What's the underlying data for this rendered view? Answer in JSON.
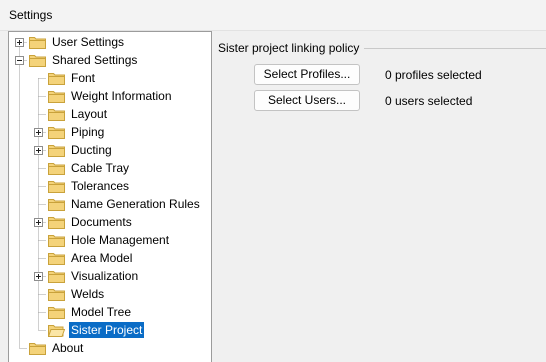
{
  "window": {
    "title": "Settings"
  },
  "tree": {
    "items": [
      {
        "label": "User Settings",
        "level": 0,
        "expander": "plus"
      },
      {
        "label": "Shared Settings",
        "level": 0,
        "expander": "minus"
      },
      {
        "label": "Font",
        "level": 1,
        "expander": ""
      },
      {
        "label": "Weight Information",
        "level": 1,
        "expander": ""
      },
      {
        "label": "Layout",
        "level": 1,
        "expander": ""
      },
      {
        "label": "Piping",
        "level": 1,
        "expander": "plus"
      },
      {
        "label": "Ducting",
        "level": 1,
        "expander": "plus"
      },
      {
        "label": "Cable Tray",
        "level": 1,
        "expander": ""
      },
      {
        "label": "Tolerances",
        "level": 1,
        "expander": ""
      },
      {
        "label": "Name Generation Rules",
        "level": 1,
        "expander": ""
      },
      {
        "label": "Documents",
        "level": 1,
        "expander": "plus"
      },
      {
        "label": "Hole Management",
        "level": 1,
        "expander": ""
      },
      {
        "label": "Area Model",
        "level": 1,
        "expander": ""
      },
      {
        "label": "Visualization",
        "level": 1,
        "expander": "plus"
      },
      {
        "label": "Welds",
        "level": 1,
        "expander": ""
      },
      {
        "label": "Model Tree",
        "level": 1,
        "expander": ""
      },
      {
        "label": "Sister Project",
        "level": 1,
        "expander": "",
        "selected": true
      },
      {
        "label": "About",
        "level": 0,
        "expander": ""
      }
    ]
  },
  "panel": {
    "group_title": "Sister project linking policy",
    "select_profiles_label": "Select Profiles...",
    "profiles_status": "0 profiles selected",
    "select_users_label": "Select Users...",
    "users_status": "0 users selected"
  },
  "colors": {
    "selection": "#0a6cc6",
    "folder_fill": "#f4d37a",
    "folder_border": "#c9a23b"
  }
}
